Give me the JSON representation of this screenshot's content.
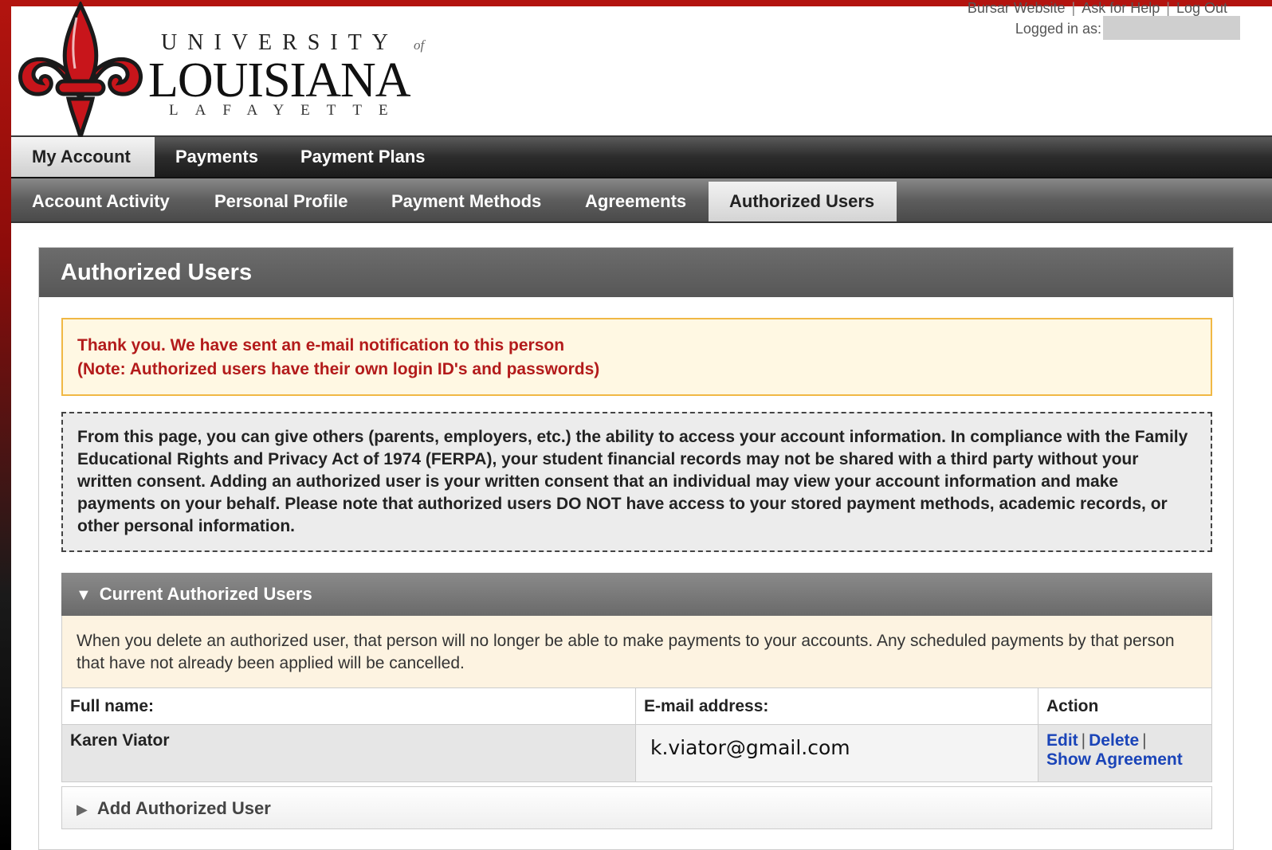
{
  "header": {
    "logo": {
      "university": "UNIVERSITY",
      "of": "of",
      "name": "LOUISIANA",
      "city": "LAFAYETTE"
    },
    "top_links": [
      "Bursar Website",
      "Ask for Help",
      "Log Out"
    ],
    "logged_in_label": "Logged in as:"
  },
  "nav": {
    "primary": [
      {
        "label": "My Account",
        "active": true
      },
      {
        "label": "Payments",
        "active": false
      },
      {
        "label": "Payment Plans",
        "active": false
      }
    ],
    "secondary": [
      {
        "label": "Account Activity",
        "active": false
      },
      {
        "label": "Personal Profile",
        "active": false
      },
      {
        "label": "Payment Methods",
        "active": false
      },
      {
        "label": "Agreements",
        "active": false
      },
      {
        "label": "Authorized Users",
        "active": true
      }
    ]
  },
  "page": {
    "title": "Authorized Users",
    "alert": {
      "line1": "Thank you. We have sent an e-mail notification to this person",
      "line2": "(Note: Authorized users have their own login ID's and passwords)"
    },
    "info": "From this page, you can give others (parents, employers, etc.) the ability to access your account information. In compliance with the Family Educational Rights and Privacy Act of 1974 (FERPA), your student financial records may not be shared with a third party without your written consent. Adding an authorized user is your written consent that an individual may view your account information and make payments on your behalf. Please note that authorized users DO NOT have access to your stored payment methods, academic records, or other personal information.",
    "current_section": {
      "title": "Current Authorized Users",
      "notice": "When you delete an authorized user, that person will no longer be able to make payments to your accounts. Any scheduled payments by that person that have not already been applied will be cancelled.",
      "columns": [
        "Full name:",
        "E-mail address:",
        "Action"
      ],
      "rows": [
        {
          "name": "Karen Viator",
          "email": "k.viator@gmail.com",
          "actions": [
            "Edit",
            "Delete",
            "Show Agreement"
          ]
        }
      ]
    },
    "add_section": {
      "title": "Add Authorized User"
    }
  },
  "colors": {
    "brand_red": "#b3140f",
    "link_blue": "#1a44b8",
    "alert_red": "#b31b1b"
  }
}
